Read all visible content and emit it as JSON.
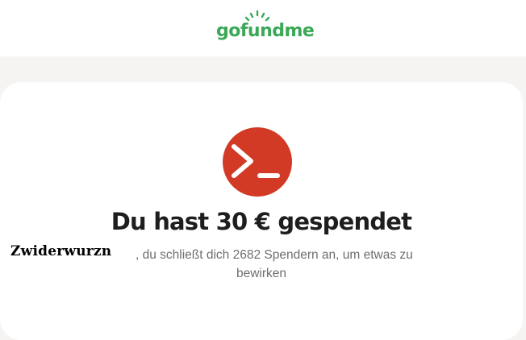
{
  "header": {
    "logo_text": "gofundme",
    "brand_color": "#3aa856"
  },
  "confirmation": {
    "icon": "terminal-prompt-icon",
    "icon_color": "#d23a26",
    "headline": "Du hast 30 € gespendet",
    "donor_name": "Zwiderwurzn",
    "message_line1": ", du schließt dich 2682 Spendern an, um etwas zu",
    "message_line2": "bewirken"
  }
}
